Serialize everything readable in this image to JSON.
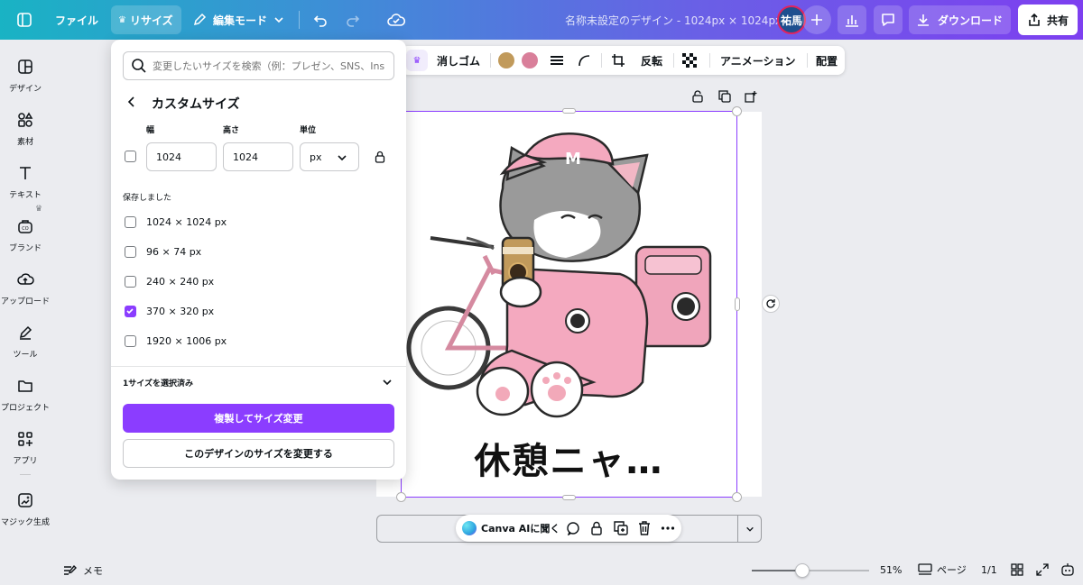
{
  "topbar": {
    "file": "ファイル",
    "resize": "リサイズ",
    "edit_mode": "編集モード",
    "doc_title": "名称未設定のデザイン - 1024px × 1024px",
    "avatar": "祐馬",
    "download": "ダウンロード",
    "share": "共有"
  },
  "sidebar": {
    "items": [
      {
        "label": "デザイン"
      },
      {
        "label": "素材"
      },
      {
        "label": "テキスト"
      },
      {
        "label": "ブランド"
      },
      {
        "label": "アップロード"
      },
      {
        "label": "ツール"
      },
      {
        "label": "プロジェクト"
      },
      {
        "label": "アプリ"
      },
      {
        "label": "マジック生成"
      }
    ]
  },
  "context_bar": {
    "eraser": "消しゴム",
    "flip": "反転",
    "animation": "アニメーション",
    "position": "配置",
    "colors": [
      "#c19a5b",
      "#d97f9a"
    ]
  },
  "resize_panel": {
    "search_placeholder": "変更したいサイズを検索（例：プレゼン、SNS、Ins",
    "title": "カスタムサイズ",
    "width_label": "幅",
    "height_label": "高さ",
    "unit_label": "単位",
    "width_value": "1024",
    "height_value": "1024",
    "unit_value": "px",
    "saved_heading": "保存しました",
    "saved_sizes": [
      {
        "label": "1024 × 1024 px",
        "checked": false
      },
      {
        "label": "96 × 74 px",
        "checked": false
      },
      {
        "label": "240 × 240 px",
        "checked": false
      },
      {
        "label": "370 × 320 px",
        "checked": true
      },
      {
        "label": "1920 × 1006 px",
        "checked": false
      }
    ],
    "selected_count": "1サイズを選択済み",
    "primary_button": "複製してサイズ変更",
    "secondary_button": "このデザインのサイズを変更する"
  },
  "canvas": {
    "caption": "休憩ニャ…"
  },
  "float_bar": {
    "ask_ai": "Canva AIに聞く"
  },
  "bottom": {
    "notes": "メモ",
    "zoom": "51%",
    "pages": "ページ",
    "page_count": "1/1",
    "zoom_level": 0.51
  },
  "accent": "#8b3dff"
}
